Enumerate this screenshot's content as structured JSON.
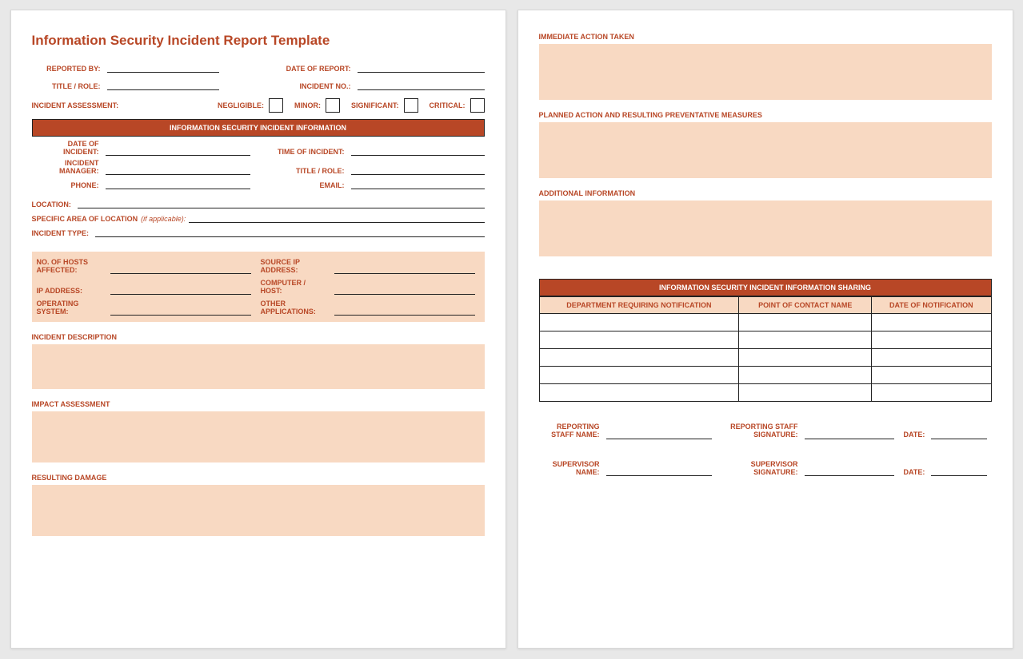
{
  "title": "Information Security Incident Report Template",
  "header": {
    "reported_by": "REPORTED BY:",
    "date_of_report": "DATE OF REPORT:",
    "title_role": "TITLE / ROLE:",
    "incident_no": "INCIDENT NO.:",
    "incident_assessment": "INCIDENT ASSESSMENT:",
    "negligible": "NEGLIGIBLE:",
    "minor": "MINOR:",
    "significant": "SIGNIFICANT:",
    "critical": "CRITICAL:"
  },
  "band1": "INFORMATION SECURITY INCIDENT INFORMATION",
  "info": {
    "date_of_incident": "DATE OF\nINCIDENT:",
    "time_of_incident": "TIME OF INCIDENT:",
    "incident_manager": "INCIDENT\nMANAGER:",
    "title_role": "TITLE / ROLE:",
    "phone": "PHONE:",
    "email": "EMAIL:",
    "location": "LOCATION:",
    "specific_area": "SPECIFIC AREA OF LOCATION",
    "if_applicable": "(if applicable):",
    "incident_type": "INCIDENT TYPE:"
  },
  "hosts": {
    "no_hosts": "NO. OF HOSTS\nAFFECTED:",
    "source_ip": "SOURCE IP\nADDRESS:",
    "ip_address": "IP ADDRESS:",
    "computer_host": "COMPUTER /\nHOST:",
    "operating_system": "OPERATING\nSYSTEM:",
    "other_apps": "OTHER\nAPPLICATIONS:"
  },
  "sections": {
    "incident_description": "INCIDENT DESCRIPTION",
    "impact_assessment": "IMPACT ASSESSMENT",
    "resulting_damage": "RESULTING DAMAGE",
    "immediate_action": "IMMEDIATE ACTION TAKEN",
    "planned_action": "PLANNED ACTION AND RESULTING PREVENTATIVE MEASURES",
    "additional_info": "ADDITIONAL INFORMATION"
  },
  "band2": "INFORMATION SECURITY INCIDENT INFORMATION SHARING",
  "table": {
    "dept": "DEPARTMENT REQUIRING NOTIFICATION",
    "poc": "POINT OF CONTACT NAME",
    "date_notif": "DATE OF NOTIFICATION"
  },
  "sig": {
    "reporting_staff_name": "REPORTING\nSTAFF NAME:",
    "reporting_staff_sig": "REPORTING STAFF\nSIGNATURE:",
    "supervisor_name": "SUPERVISOR\nNAME:",
    "supervisor_sig": "SUPERVISOR\nSIGNATURE:",
    "date": "DATE:"
  }
}
